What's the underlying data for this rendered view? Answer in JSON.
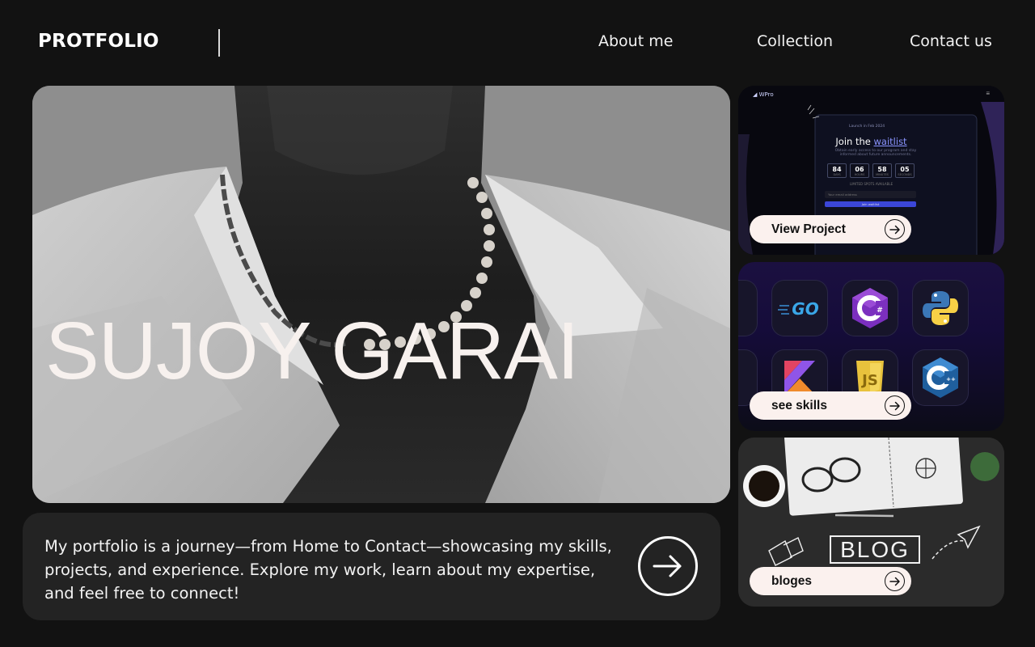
{
  "header": {
    "brand": "PROTFOLIO",
    "nav": [
      {
        "label": "About me"
      },
      {
        "label": "Collection"
      },
      {
        "label": "Contact us"
      }
    ]
  },
  "hero": {
    "name": "SUJOY GARAI"
  },
  "intro": {
    "text": "My portfolio is a journey—from Home to Contact—showcasing my skills, projects, and experience. Explore my work, learn about my expertise, and feel free to connect!",
    "arrow_icon": "arrow-right-icon"
  },
  "cards": {
    "project": {
      "button_label": "View Project",
      "preview": {
        "logo": "WPro",
        "badge": "Launch in Feb 2024",
        "title_prefix": "Join the",
        "title_highlight": "waitlist",
        "subtitle": "Obtain early access to our program and stay informed about future announcements.",
        "countdown": [
          {
            "value": "84",
            "unit": "DAYS"
          },
          {
            "value": "06",
            "unit": "HOURS"
          },
          {
            "value": "58",
            "unit": "MINUTES"
          },
          {
            "value": "05",
            "unit": "SECONDS"
          }
        ],
        "note": "LIMITED SPOTS AVAILABLE",
        "input_placeholder": "Your email address",
        "join_label": "Join waitlist"
      }
    },
    "skills": {
      "button_label": "see skills",
      "tiles": [
        {
          "label": "GO",
          "icon": "golang-icon"
        },
        {
          "label": "C#",
          "icon": "csharp-icon"
        },
        {
          "label": "",
          "icon": "python-icon"
        },
        {
          "label": "",
          "icon": "kotlin-icon"
        },
        {
          "label": "JS",
          "icon": "javascript-icon"
        },
        {
          "label": "C++",
          "icon": "cplusplus-icon"
        }
      ]
    },
    "blog": {
      "button_label": "bloges",
      "sign": "BLOG"
    }
  },
  "colors": {
    "background": "#121212",
    "panel": "#232323",
    "button": "#fbf1ee",
    "accent": "#8a94ff"
  }
}
